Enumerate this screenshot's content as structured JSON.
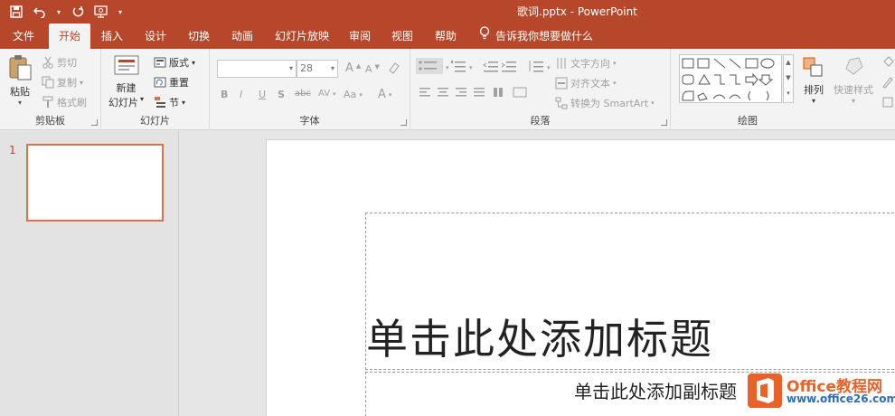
{
  "window": {
    "title": "歌词.pptx  -  PowerPoint"
  },
  "qat": {
    "save": "save-icon",
    "undo": "undo-icon",
    "redo": "redo-icon",
    "present": "present-from-start-icon",
    "customize": "customize-qat-icon"
  },
  "tabs": [
    {
      "label": "文件"
    },
    {
      "label": "开始"
    },
    {
      "label": "插入"
    },
    {
      "label": "设计"
    },
    {
      "label": "切换"
    },
    {
      "label": "动画"
    },
    {
      "label": "幻灯片放映"
    },
    {
      "label": "审阅"
    },
    {
      "label": "视图"
    },
    {
      "label": "帮助"
    }
  ],
  "tell_me": "告诉我你想要做什么",
  "ribbon": {
    "clipboard": {
      "label": "剪贴板",
      "paste": "粘贴",
      "cut": "剪切",
      "copy": "复制",
      "format_painter": "格式刷"
    },
    "slides": {
      "label": "幻灯片",
      "new_slide_1": "新建",
      "new_slide_2": "幻灯片",
      "layout": "版式",
      "reset": "重置",
      "section": "节"
    },
    "font": {
      "label": "字体",
      "font_name": "",
      "font_size": "28",
      "bold": "B",
      "italic": "I",
      "underline": "U",
      "shadow": "S",
      "strike": "abc",
      "spacing": "AV",
      "case": "Aa",
      "grow": "A",
      "shrink": "A",
      "clear": "A"
    },
    "paragraph": {
      "label": "段落",
      "text_direction": "文字方向",
      "align_text": "对齐文本",
      "smartart": "转换为 SmartArt"
    },
    "drawing": {
      "label": "绘图",
      "arrange": "排列",
      "quick_styles": "快速样式"
    }
  },
  "thumbnails": [
    {
      "number": "1"
    }
  ],
  "slide": {
    "title_placeholder": "单击此处添加标题",
    "subtitle_placeholder": "单击此处添加副标题"
  },
  "watermark": {
    "line1": "Office教程网",
    "line2": "www.office26.com"
  },
  "colors": {
    "accent": "#b7472a",
    "thumb_border": "#e2704c"
  }
}
